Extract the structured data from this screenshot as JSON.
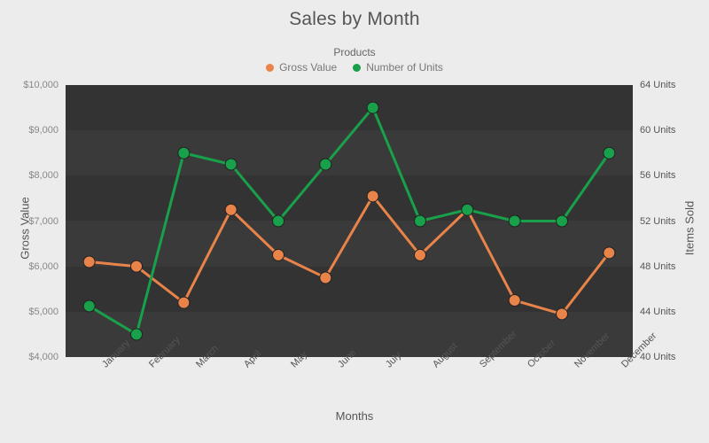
{
  "chart_data": {
    "type": "line",
    "title": "Sales by Month",
    "xlabel": "Months",
    "legend_title": "Products",
    "legend_position": "top-center",
    "grid": false,
    "categories": [
      "January",
      "February",
      "March",
      "April",
      "May",
      "June",
      "July",
      "August",
      "September",
      "October",
      "November",
      "December"
    ],
    "series": [
      {
        "name": "Gross Value",
        "color": "#E8834A",
        "axis": "left",
        "axis_label": "Gross Value",
        "values": [
          6100,
          6000,
          5200,
          7250,
          6250,
          5750,
          7550,
          6250,
          7250,
          5250,
          4950,
          6300
        ]
      },
      {
        "name": "Number of Units",
        "color": "#18A04A",
        "axis": "right",
        "axis_label": "Items Sold",
        "values": [
          44.5,
          42,
          58,
          57,
          52,
          57,
          62,
          52,
          53,
          52,
          52,
          58
        ]
      }
    ],
    "left_axis": {
      "label": "Gross Value",
      "min": 4000,
      "max": 10000,
      "step": 1000,
      "tick_labels": [
        "$4,000",
        "$5,000",
        "$6,000",
        "$7,000",
        "$8,000",
        "$9,000",
        "$10,000"
      ]
    },
    "right_axis": {
      "label": "Items Sold",
      "min": 40,
      "max": 64,
      "step": 4,
      "tick_labels": [
        "40 Units",
        "44 Units",
        "48 Units",
        "52 Units",
        "56 Units",
        "60 Units",
        "64 Units"
      ]
    },
    "plot_background": "#3a3a3a",
    "band_color_alt": "#333333",
    "page_background": "#ececec"
  }
}
